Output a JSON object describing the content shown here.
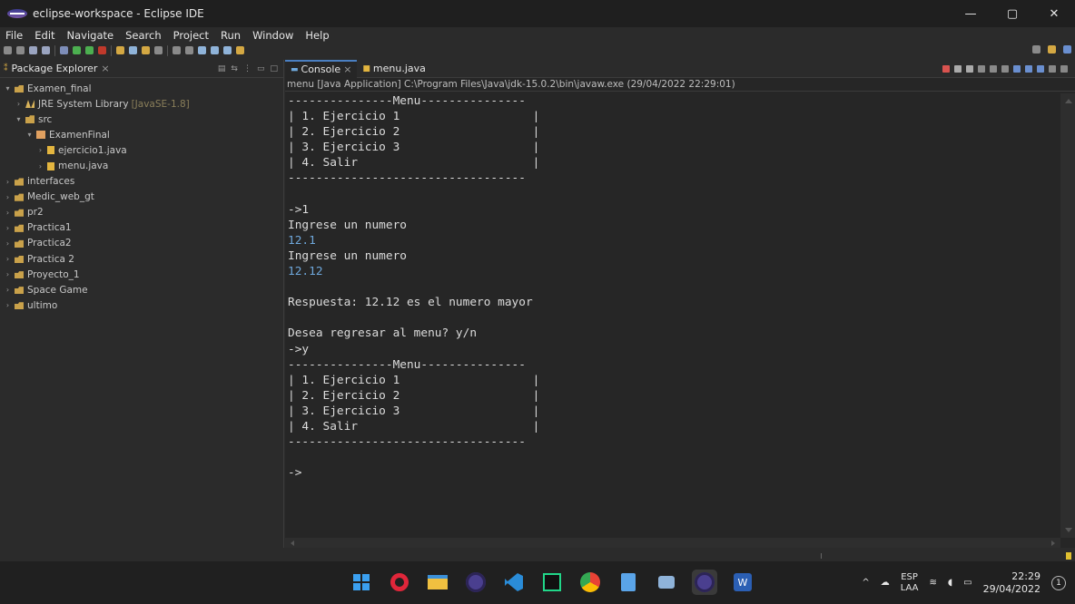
{
  "window": {
    "title": "eclipse-workspace - Eclipse IDE",
    "controls": [
      "—",
      "▢",
      "✕"
    ]
  },
  "menu": [
    "File",
    "Edit",
    "Navigate",
    "Search",
    "Project",
    "Run",
    "Window",
    "Help"
  ],
  "package_explorer": {
    "tab_label": "Package Explorer",
    "close": "×",
    "items": [
      {
        "arrow": "▾",
        "icon": "project-icon",
        "label": "Examen_final",
        "suffix": ""
      },
      {
        "arrow": "›",
        "icon": "library-icon",
        "label": "JRE System Library",
        "suffix": "[JavaSE-1.8]"
      },
      {
        "arrow": "▾",
        "icon": "source-folder-icon",
        "label": "src",
        "suffix": ""
      },
      {
        "arrow": "▾",
        "icon": "package-icon",
        "label": "ExamenFinal",
        "suffix": ""
      },
      {
        "arrow": "›",
        "icon": "java-file-icon",
        "label": "ejercicio1.java",
        "suffix": ""
      },
      {
        "arrow": "›",
        "icon": "java-file-icon",
        "label": "menu.java",
        "suffix": ""
      },
      {
        "arrow": "›",
        "icon": "project-icon",
        "label": "interfaces",
        "suffix": ""
      },
      {
        "arrow": "›",
        "icon": "project-icon",
        "label": "Medic_web_gt",
        "suffix": ""
      },
      {
        "arrow": "›",
        "icon": "project-icon",
        "label": "pr2",
        "suffix": ""
      },
      {
        "arrow": "›",
        "icon": "project-icon",
        "label": "Practica1",
        "suffix": ""
      },
      {
        "arrow": "›",
        "icon": "project-icon",
        "label": "Practica2",
        "suffix": ""
      },
      {
        "arrow": "›",
        "icon": "project-icon",
        "label": "Practica 2",
        "suffix": ""
      },
      {
        "arrow": "›",
        "icon": "project-icon",
        "label": "Proyecto_1",
        "suffix": ""
      },
      {
        "arrow": "›",
        "icon": "project-icon",
        "label": "Space Game",
        "suffix": ""
      },
      {
        "arrow": "›",
        "icon": "project-icon",
        "label": "ultimo",
        "suffix": ""
      }
    ]
  },
  "console": {
    "tabs": [
      {
        "label": "Console",
        "close": "×"
      },
      {
        "label": "menu.java",
        "close": ""
      }
    ],
    "status": "menu [Java Application] C:\\Program Files\\Java\\jdk-15.0.2\\bin\\javaw.exe  (29/04/2022 22:29:01)",
    "lines": [
      {
        "text": "---------------Menu---------------",
        "input": false
      },
      {
        "text": "| 1. Ejercicio 1                   |",
        "input": false
      },
      {
        "text": "| 2. Ejercicio 2                   |",
        "input": false
      },
      {
        "text": "| 3. Ejercicio 3                   |",
        "input": false
      },
      {
        "text": "| 4. Salir                         |",
        "input": false
      },
      {
        "text": "----------------------------------",
        "input": false
      },
      {
        "text": "",
        "input": false
      },
      {
        "text": "->1",
        "input": false
      },
      {
        "text": "Ingrese un numero",
        "input": false
      },
      {
        "text": "12.1",
        "input": true
      },
      {
        "text": "Ingrese un numero",
        "input": false
      },
      {
        "text": "12.12",
        "input": true
      },
      {
        "text": "",
        "input": false
      },
      {
        "text": "Respuesta: 12.12 es el numero mayor",
        "input": false
      },
      {
        "text": "",
        "input": false
      },
      {
        "text": "Desea regresar al menu? y/n",
        "input": false
      },
      {
        "text": "->y",
        "input": false
      },
      {
        "text": "---------------Menu---------------",
        "input": false
      },
      {
        "text": "| 1. Ejercicio 1                   |",
        "input": false
      },
      {
        "text": "| 2. Ejercicio 2                   |",
        "input": false
      },
      {
        "text": "| 3. Ejercicio 3                   |",
        "input": false
      },
      {
        "text": "| 4. Salir                         |",
        "input": false
      },
      {
        "text": "----------------------------------",
        "input": false
      },
      {
        "text": "",
        "input": false
      },
      {
        "text": "->",
        "input": false
      }
    ]
  },
  "taskbar": {
    "apps": [
      "windows-start-icon",
      "opera-icon",
      "file-explorer-icon",
      "eclipse-icon",
      "vscode-icon",
      "pycharm-icon",
      "chrome-icon",
      "notepad-icon",
      "app-icon",
      "eclipse-icon",
      "word-icon"
    ],
    "language": {
      "top": "ESP",
      "bottom": "LAA"
    },
    "time": "22:29",
    "date": "29/04/2022"
  },
  "colors": {
    "background": "#2b2b2b",
    "console_bg": "#262626",
    "console_input": "#6fa8dc",
    "active_tab": "#4a7fc1",
    "taskbar": "#202020"
  }
}
